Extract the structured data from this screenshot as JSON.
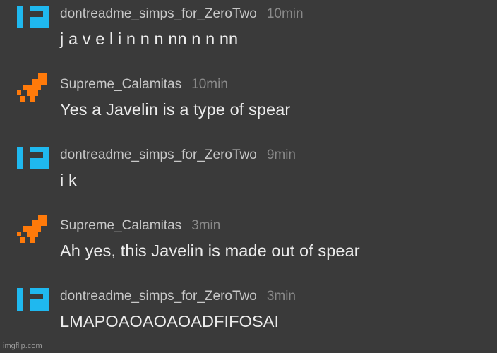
{
  "colors": {
    "background": "#3a3a3a",
    "blue_avatar": "#1fb8ef",
    "orange_avatar": "#ff7a0a"
  },
  "messages": [
    {
      "avatar": "blue-pixel-avatar-icon",
      "username": "dontreadme_simps_for_ZeroTwo",
      "time": "10min",
      "text": "j a v e l i n n n nn n n nn"
    },
    {
      "avatar": "orange-pixel-avatar-icon",
      "username": "Supreme_Calamitas",
      "time": "10min",
      "text": "Yes a Javelin is a type of spear"
    },
    {
      "avatar": "blue-pixel-avatar-icon",
      "username": "dontreadme_simps_for_ZeroTwo",
      "time": "9min",
      "text": "i k"
    },
    {
      "avatar": "orange-pixel-avatar-icon",
      "username": "Supreme_Calamitas",
      "time": "3min",
      "text": "Ah yes, this Javelin is made out of spear"
    },
    {
      "avatar": "blue-pixel-avatar-icon",
      "username": "dontreadme_simps_for_ZeroTwo",
      "time": "3min",
      "text": "LMAPOAOAOAOADFIFOSAI"
    }
  ],
  "watermark": "imgflip.com"
}
